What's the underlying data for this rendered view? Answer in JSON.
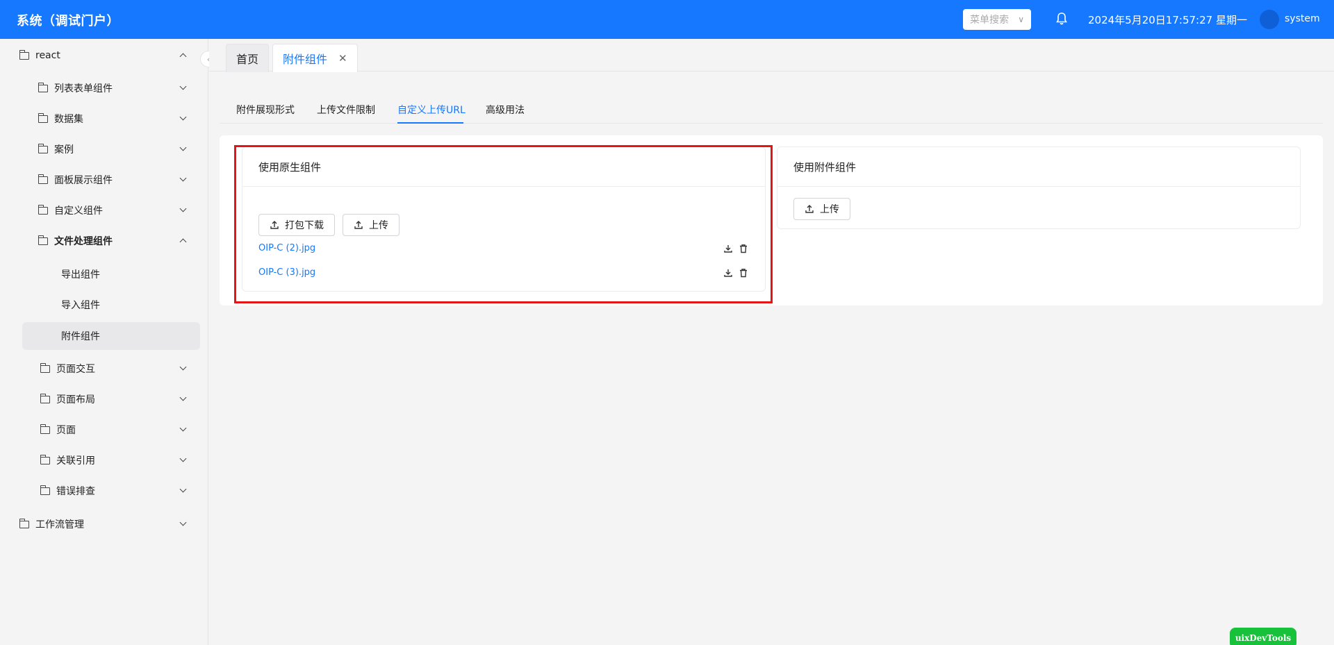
{
  "header": {
    "app_title": "系统（调试门户）",
    "search_placeholder": "菜单搜索",
    "datetime": "2024年5月20日17:57:27 星期一",
    "username": "system"
  },
  "sidebar": {
    "root": "react",
    "items": [
      {
        "label": "列表表单组件"
      },
      {
        "label": "数据集"
      },
      {
        "label": "案例"
      },
      {
        "label": "面板展示组件"
      },
      {
        "label": "自定义组件"
      },
      {
        "label": "文件处理组件"
      },
      {
        "label": "导出组件"
      },
      {
        "label": "导入组件"
      },
      {
        "label": "附件组件"
      },
      {
        "label": "页面交互"
      },
      {
        "label": "页面布局"
      },
      {
        "label": "页面"
      },
      {
        "label": "关联引用"
      },
      {
        "label": "错误排查"
      }
    ],
    "workflow": "工作流管理"
  },
  "page_tabs": [
    {
      "label": "首页"
    },
    {
      "label": "附件组件"
    }
  ],
  "inner_tabs": [
    {
      "label": "附件展现形式"
    },
    {
      "label": "上传文件限制"
    },
    {
      "label": "自定义上传URL"
    },
    {
      "label": "高级用法"
    }
  ],
  "native_card": {
    "title": "使用原生组件",
    "pack_download": "打包下载",
    "upload": "上传",
    "files": [
      {
        "name": "OIP-C (2).jpg"
      },
      {
        "name": "OIP-C (3).jpg"
      }
    ]
  },
  "attach_card": {
    "title": "使用附件组件",
    "upload": "上传"
  },
  "devtools": "uixDevTools",
  "colors": {
    "primary": "#1677ff",
    "highlight": "#e41515",
    "devtools": "#17c13a"
  }
}
